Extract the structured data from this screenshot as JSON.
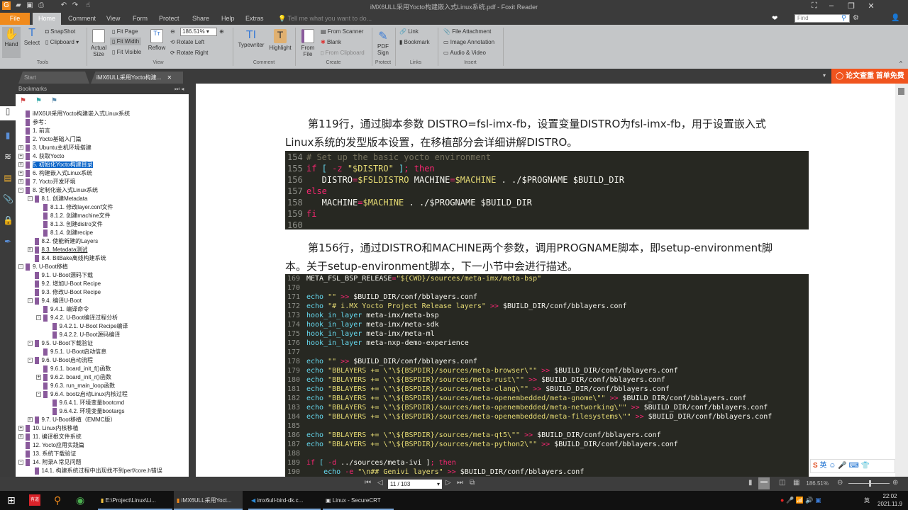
{
  "window": {
    "title": "iMX6ULL采用Yocto构建嵌入式Linux系统.pdf - Foxit Reader"
  },
  "menu": [
    "File",
    "Home",
    "Comment",
    "View",
    "Form",
    "Protect",
    "Share",
    "Help",
    "Extras"
  ],
  "tell_me": "Tell me what you want to do...",
  "find_placeholder": "Find",
  "ribbon": {
    "hand": "Hand",
    "select": "Select",
    "snapshot": "SnapShot",
    "clipboard": "Clipboard",
    "tools": "Tools",
    "actual_size": "Actual Size",
    "fit_page": "Fit Page",
    "fit_width": "Fit Width",
    "fit_visible": "Fit Visible",
    "reflow": "Reflow",
    "zoom": "186.51%",
    "rotate_left": "Rotate Left",
    "rotate_right": "Rotate Right",
    "view": "View",
    "typewriter": "Typewriter",
    "highlight": "Highlight",
    "comment": "Comment",
    "from_file": "From File",
    "from_scanner": "From Scanner",
    "blank": "Blank",
    "from_clipboard": "From Clipboard",
    "create": "Create",
    "pdf_sign": "PDF Sign",
    "protect": "Protect",
    "link": "Link",
    "bookmark": "Bookmark",
    "links": "Links",
    "file_attachment": "File Attachment",
    "image_annotation": "Image Annotation",
    "audio_video": "Audio & Video",
    "insert": "Insert"
  },
  "doc_tabs": [
    "Start",
    "iMX6ULL采用Yocto构建..."
  ],
  "promo": "论文查重 首单免费",
  "bookmarks": {
    "header": "Bookmarks",
    "items": [
      {
        "l": 0,
        "e": "",
        "t": "iMX6UI采用Yocto构建嵌入式Linux系统"
      },
      {
        "l": 0,
        "e": "",
        "t": "参考："
      },
      {
        "l": 0,
        "e": "",
        "t": "1. 前言"
      },
      {
        "l": 0,
        "e": "",
        "t": "2. Yocto基础入门篇"
      },
      {
        "l": 0,
        "e": "+",
        "t": "3. Ubuntu主机环境搭建"
      },
      {
        "l": 0,
        "e": "+",
        "t": "4. 获取Yocto"
      },
      {
        "l": 0,
        "e": "+",
        "t": "5. 初始化Yocto构建目录",
        "sel": true
      },
      {
        "l": 0,
        "e": "+",
        "t": "6. 构建嵌入式Linux系统"
      },
      {
        "l": 0,
        "e": "+",
        "t": "7. Yocto开发环境"
      },
      {
        "l": 0,
        "e": "-",
        "t": "8. 定制化嵌入式Linux系统"
      },
      {
        "l": 1,
        "e": "-",
        "t": "8.1. 创建Metadata"
      },
      {
        "l": 2,
        "e": "",
        "t": "8.1.1. 修改layer.conf文件"
      },
      {
        "l": 2,
        "e": "",
        "t": "8.1.2. 创建machine文件"
      },
      {
        "l": 2,
        "e": "",
        "t": "8.1.3. 创建distro文件"
      },
      {
        "l": 2,
        "e": "",
        "t": "8.1.4. 创建recipe"
      },
      {
        "l": 1,
        "e": "",
        "t": "8.2. 使能新建的Layers"
      },
      {
        "l": 1,
        "e": "+",
        "t": "8.3. Metadata测试",
        "ul": true
      },
      {
        "l": 1,
        "e": "",
        "t": "8.4. BitBake离线构建系统"
      },
      {
        "l": 0,
        "e": "-",
        "t": "9. U-Boot移植"
      },
      {
        "l": 1,
        "e": "",
        "t": "9.1. U-Boot源码下载"
      },
      {
        "l": 1,
        "e": "",
        "t": "9.2. 增加U-Boot Recipe"
      },
      {
        "l": 1,
        "e": "",
        "t": "9.3. 修改U-Boot Recipe"
      },
      {
        "l": 1,
        "e": "-",
        "t": "9.4. 编译U-Boot"
      },
      {
        "l": 2,
        "e": "",
        "t": "9.4.1. 编译命令"
      },
      {
        "l": 2,
        "e": "-",
        "t": "9.4.2. U-Boot编译过程分析"
      },
      {
        "l": 3,
        "e": "",
        "t": "9.4.2.1. U-Boot Recipe编译"
      },
      {
        "l": 3,
        "e": "",
        "t": "9.4.2.2. U-Boot源码编译"
      },
      {
        "l": 1,
        "e": "-",
        "t": "9.5. U-Boot下载验证"
      },
      {
        "l": 2,
        "e": "",
        "t": "9.5.1. U-Boot启动信息"
      },
      {
        "l": 1,
        "e": "-",
        "t": "9.6. U-Boot启动流程"
      },
      {
        "l": 2,
        "e": "",
        "t": "9.6.1. board_init_f()函数"
      },
      {
        "l": 2,
        "e": "+",
        "t": "9.6.2. board_init_r()函数"
      },
      {
        "l": 2,
        "e": "",
        "t": "9.6.3. run_main_loop函数"
      },
      {
        "l": 2,
        "e": "-",
        "t": "9.6.4. bootz启动Linux内核过程"
      },
      {
        "l": 3,
        "e": "",
        "t": "9.6.4.1. 环境变量bootcmd"
      },
      {
        "l": 3,
        "e": "",
        "t": "9.6.4.2. 环境变量bootargs"
      },
      {
        "l": 1,
        "e": "+",
        "t": "9.7. U-Boot移植（EMMC版）"
      },
      {
        "l": 0,
        "e": "+",
        "t": "10. Linux内核移植"
      },
      {
        "l": 0,
        "e": "+",
        "t": "11. 编译根文件系统"
      },
      {
        "l": 0,
        "e": "",
        "t": "12. Yocto应用实践篇"
      },
      {
        "l": 0,
        "e": "",
        "t": "13. 系统下载验证"
      },
      {
        "l": 0,
        "e": "-",
        "t": "14. 附录A 常见问题"
      },
      {
        "l": 1,
        "e": "",
        "t": "14.1. 构建系统过程中出现找不到perf/core.h错误"
      }
    ]
  },
  "doc": {
    "p1_line1": "第119行，通过脚本参数 DISTRO=fsl-imx-fb，设置变量DISTRO为fsl-imx-fb，用于设置嵌入式",
    "p1_line2": "Linux系统的发型版本设置，在移植部分会详细讲解DISTRO。",
    "p2_line1": "第156行，通过DISTRO和MACHINE两个参数，调用PROGNAME脚本，即setup-environment脚",
    "p2_line2": "本。关于setup-environment脚本，下一小节中会进行描述。",
    "code1": [
      [
        "154",
        [
          [
            "c",
            "# Set up the basic yocto environment"
          ]
        ]
      ],
      [
        "155",
        [
          [
            "k",
            "if"
          ],
          [
            "f",
            " [ "
          ],
          [
            "k",
            "-z"
          ],
          [
            "s",
            " \"$DISTRO\""
          ],
          [
            "f",
            " ]"
          ],
          [
            "k",
            "; then"
          ]
        ]
      ],
      [
        "156",
        [
          [
            "w",
            "   DISTRO"
          ],
          [
            "k",
            "="
          ],
          [
            "y",
            "$FSLDISTRO"
          ],
          [
            "w",
            " MACHINE"
          ],
          [
            "k",
            "="
          ],
          [
            "y",
            "$MACHINE"
          ],
          [
            "w",
            " . ./$PROGNAME $BUILD_DIR"
          ]
        ]
      ],
      [
        "157",
        [
          [
            "k",
            "else"
          ]
        ]
      ],
      [
        "158",
        [
          [
            "w",
            "   MACHINE"
          ],
          [
            "k",
            "="
          ],
          [
            "y",
            "$MACHINE"
          ],
          [
            "w",
            " . ./$PROGNAME $BUILD_DIR"
          ]
        ]
      ],
      [
        "159",
        [
          [
            "k",
            "fi"
          ]
        ]
      ],
      [
        "160",
        []
      ]
    ],
    "code2": [
      [
        "169",
        [
          [
            "w",
            "META_FSL_BSP_RELEASE"
          ],
          [
            "k",
            "="
          ],
          [
            "s",
            "\"${CWD}/sources/meta-imx/meta-bsp\""
          ]
        ]
      ],
      [
        "170",
        []
      ],
      [
        "171",
        [
          [
            "f",
            "echo"
          ],
          [
            "s",
            " \"\""
          ],
          [
            "k",
            " >>"
          ],
          [
            "w",
            " $BUILD_DIR/conf/bblayers.conf"
          ]
        ]
      ],
      [
        "172",
        [
          [
            "f",
            "echo"
          ],
          [
            "s",
            " \"# i.MX Yocto Project Release layers\""
          ],
          [
            "k",
            " >>"
          ],
          [
            "w",
            " $BUILD_DIR/conf/bblayers.conf"
          ]
        ]
      ],
      [
        "173",
        [
          [
            "f",
            "hook_in_layer"
          ],
          [
            "w",
            " meta-imx/meta-bsp"
          ]
        ]
      ],
      [
        "174",
        [
          [
            "f",
            "hook_in_layer"
          ],
          [
            "w",
            " meta-imx/meta-sdk"
          ]
        ]
      ],
      [
        "175",
        [
          [
            "f",
            "hook_in_layer"
          ],
          [
            "w",
            " meta-imx/meta-ml"
          ]
        ]
      ],
      [
        "176",
        [
          [
            "f",
            "hook_in_layer"
          ],
          [
            "w",
            " meta-nxp-demo-experience"
          ]
        ]
      ],
      [
        "177",
        []
      ],
      [
        "178",
        [
          [
            "f",
            "echo"
          ],
          [
            "s",
            " \"\""
          ],
          [
            "k",
            " >>"
          ],
          [
            "w",
            " $BUILD_DIR/conf/bblayers.conf"
          ]
        ]
      ],
      [
        "179",
        [
          [
            "f",
            "echo"
          ],
          [
            "s",
            " \"BBLAYERS += \\\"\\${BSPDIR}/sources/meta-browser\\\"\""
          ],
          [
            "k",
            " >>"
          ],
          [
            "w",
            " $BUILD_DIR/conf/bblayers.conf"
          ]
        ]
      ],
      [
        "180",
        [
          [
            "f",
            "echo"
          ],
          [
            "s",
            " \"BBLAYERS += \\\"\\${BSPDIR}/sources/meta-rust\\\"\""
          ],
          [
            "k",
            " >>"
          ],
          [
            "w",
            " $BUILD_DIR/conf/bblayers.conf"
          ]
        ]
      ],
      [
        "181",
        [
          [
            "f",
            "echo"
          ],
          [
            "s",
            " \"BBLAYERS += \\\"\\${BSPDIR}/sources/meta-clang\\\"\""
          ],
          [
            "k",
            " >>"
          ],
          [
            "w",
            " $BUILD_DIR/conf/bblayers.conf"
          ]
        ]
      ],
      [
        "182",
        [
          [
            "f",
            "echo"
          ],
          [
            "s",
            " \"BBLAYERS += \\\"\\${BSPDIR}/sources/meta-openembedded/meta-gnome\\\"\""
          ],
          [
            "k",
            " >>"
          ],
          [
            "w",
            " $BUILD_DIR/conf/bblayers.conf"
          ]
        ]
      ],
      [
        "183",
        [
          [
            "f",
            "echo"
          ],
          [
            "s",
            " \"BBLAYERS += \\\"\\${BSPDIR}/sources/meta-openembedded/meta-networking\\\"\""
          ],
          [
            "k",
            " >>"
          ],
          [
            "w",
            " $BUILD_DIR/conf/bblayers.conf"
          ]
        ]
      ],
      [
        "184",
        [
          [
            "f",
            "echo"
          ],
          [
            "s",
            " \"BBLAYERS += \\\"\\${BSPDIR}/sources/meta-openembedded/meta-filesystems\\\"\""
          ],
          [
            "k",
            " >>"
          ],
          [
            "w",
            " $BUILD_DIR/conf/bblayers.conf"
          ]
        ]
      ],
      [
        "185",
        []
      ],
      [
        "186",
        [
          [
            "f",
            "echo"
          ],
          [
            "s",
            " \"BBLAYERS += \\\"\\${BSPDIR}/sources/meta-qt5\\\"\""
          ],
          [
            "k",
            " >>"
          ],
          [
            "w",
            " $BUILD_DIR/conf/bblayers.conf"
          ]
        ]
      ],
      [
        "187",
        [
          [
            "f",
            "echo"
          ],
          [
            "s",
            " \"BBLAYERS += \\\"\\${BSPDIR}/sources/meta-python2\\\"\""
          ],
          [
            "k",
            " >>"
          ],
          [
            "w",
            " $BUILD_DIR/conf/bblayers.conf"
          ]
        ]
      ],
      [
        "188",
        []
      ],
      [
        "189",
        [
          [
            "k",
            "if"
          ],
          [
            "f",
            " [ "
          ],
          [
            "k",
            "-d"
          ],
          [
            "w",
            " ../sources/meta-ivi ]"
          ],
          [
            "k",
            "; then"
          ]
        ]
      ],
      [
        "190",
        [
          [
            "f",
            "    echo"
          ],
          [
            "k",
            " -e"
          ],
          [
            "s",
            " \"\\n## Genivi layers\""
          ],
          [
            "k",
            " >>"
          ],
          [
            "w",
            " $BUILD_DIR/conf/bblayers.conf"
          ]
        ]
      ]
    ]
  },
  "status": {
    "page": "11 / 103",
    "zoom": "186.51%"
  },
  "ime": "英",
  "taskbar": {
    "items": [
      "E:\\Project\\Linux\\Li...",
      "iMX6ULL采用Yoct...",
      "imx6ull-bird-dk.c...",
      "Linux - SecureCRT"
    ],
    "youdao": "有道",
    "lang": "英",
    "time": "22:02",
    "date": "2021.11.9"
  },
  "colors": {
    "accent": "#f08a1c",
    "promo": "#f0541e",
    "selection": "#0a64c8",
    "code_bg": "#272822"
  }
}
